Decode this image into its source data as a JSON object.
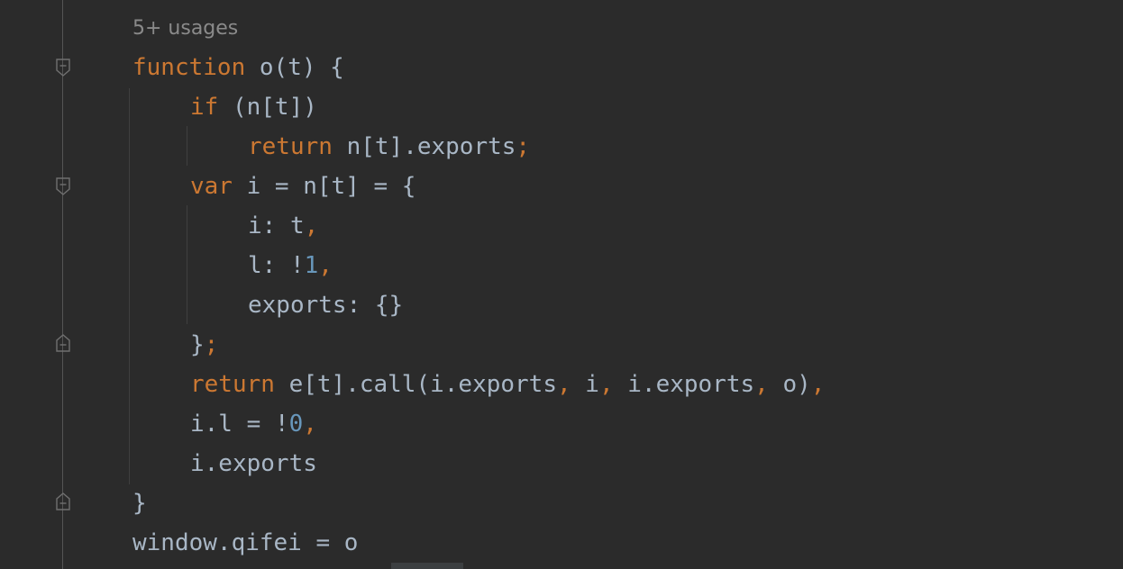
{
  "editor": {
    "usages_hint": "5+ usages",
    "lines": [
      {
        "parts": [
          {
            "t": "function",
            "c": "kw"
          },
          {
            "t": " o(t) {",
            "c": "plain"
          }
        ]
      },
      {
        "parts": [
          {
            "t": "if",
            "c": "kw"
          },
          {
            "t": " (n[t])",
            "c": "plain"
          }
        ]
      },
      {
        "parts": [
          {
            "t": "return",
            "c": "kw"
          },
          {
            "t": " n[t].exports",
            "c": "plain"
          },
          {
            "t": ";",
            "c": "punc"
          }
        ]
      },
      {
        "parts": [
          {
            "t": "var",
            "c": "kw"
          },
          {
            "t": " i = n[t] = {",
            "c": "plain"
          }
        ]
      },
      {
        "parts": [
          {
            "t": "i: t",
            "c": "plain"
          },
          {
            "t": ",",
            "c": "punc"
          }
        ]
      },
      {
        "parts": [
          {
            "t": "l: !",
            "c": "plain"
          },
          {
            "t": "1",
            "c": "num"
          },
          {
            "t": ",",
            "c": "punc"
          }
        ]
      },
      {
        "parts": [
          {
            "t": "exports: {}",
            "c": "plain"
          }
        ]
      },
      {
        "parts": [
          {
            "t": "}",
            "c": "plain"
          },
          {
            "t": ";",
            "c": "punc"
          }
        ]
      },
      {
        "parts": [
          {
            "t": "return",
            "c": "kw"
          },
          {
            "t": " e[t].call(i.exports",
            "c": "plain"
          },
          {
            "t": ",",
            "c": "punc"
          },
          {
            "t": " i",
            "c": "plain"
          },
          {
            "t": ",",
            "c": "punc"
          },
          {
            "t": " i.exports",
            "c": "plain"
          },
          {
            "t": ",",
            "c": "punc"
          },
          {
            "t": " o)",
            "c": "plain"
          },
          {
            "t": ",",
            "c": "punc"
          }
        ]
      },
      {
        "parts": [
          {
            "t": "i.l = !",
            "c": "plain"
          },
          {
            "t": "0",
            "c": "num"
          },
          {
            "t": ",",
            "c": "punc"
          }
        ]
      },
      {
        "parts": [
          {
            "t": "i.exports",
            "c": "plain"
          }
        ]
      },
      {
        "parts": [
          {
            "t": "}",
            "c": "plain"
          }
        ]
      },
      {
        "parts": [
          {
            "t": "window.qifei = o",
            "c": "plain"
          }
        ]
      }
    ]
  },
  "colors": {
    "background": "#2b2b2b",
    "keyword": "#cc7832",
    "number": "#6897bb",
    "identifier": "#a9b7c6",
    "hint": "#8a8a8a"
  }
}
